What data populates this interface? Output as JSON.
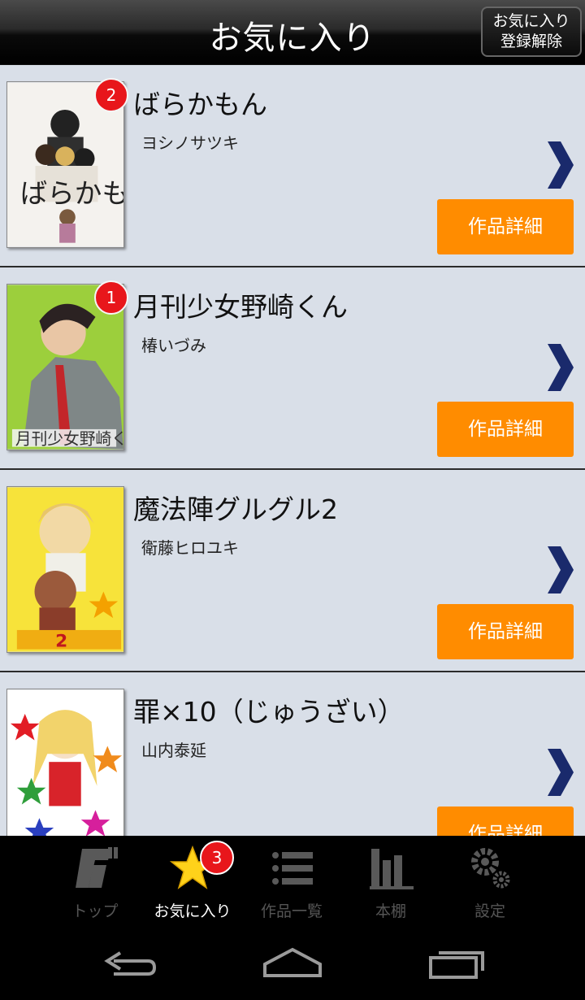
{
  "header": {
    "title": "お気に入り",
    "unfavorite_button": [
      "お気に入り",
      "登録解除"
    ]
  },
  "items": [
    {
      "badge": "2",
      "title": "ばらかもん",
      "author": "ヨシノサツキ",
      "detail_label": "作品詳細"
    },
    {
      "badge": "1",
      "title": "月刊少女野崎くん",
      "author": "椿いづみ",
      "detail_label": "作品詳細"
    },
    {
      "badge": "",
      "title": "魔法陣グルグル2",
      "author": "衛藤ヒロユキ",
      "detail_label": "作品詳細"
    },
    {
      "badge": "",
      "title": "罪×10（じゅうざい）",
      "author": "山内泰延",
      "detail_label": "作品詳細"
    }
  ],
  "tabs": [
    {
      "label": "トップ",
      "icon": "ga-logo-icon"
    },
    {
      "label": "お気に入り",
      "icon": "star-icon",
      "badge": "3"
    },
    {
      "label": "作品一覧",
      "icon": "list-icon"
    },
    {
      "label": "本棚",
      "icon": "bookshelf-icon"
    },
    {
      "label": "設定",
      "icon": "gear-icon"
    }
  ],
  "colors": {
    "accent": "#ff8c00",
    "badge": "#e8161b",
    "list_background": "#d9dfe8",
    "chevron": "#1a2a6c"
  }
}
